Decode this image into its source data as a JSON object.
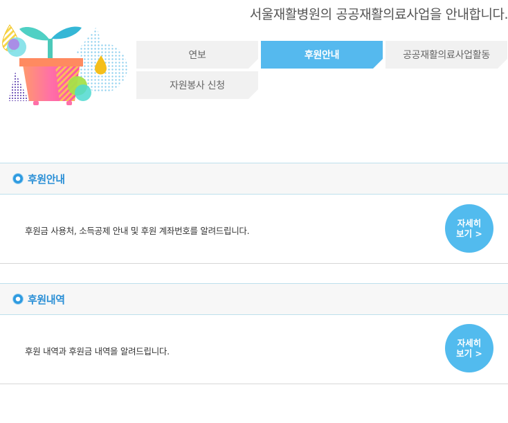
{
  "header": {
    "title": "서울재활병원의 공공재활의료사업을 안내합니다."
  },
  "tabs": [
    {
      "label": "연보",
      "active": false
    },
    {
      "label": "후원안내",
      "active": true
    },
    {
      "label": "공공재활의료사업활동",
      "active": false
    },
    {
      "label": "자원봉사 신청",
      "active": false
    }
  ],
  "sections": [
    {
      "title": "후원안내",
      "description": "후원금 사용처, 소득공제 안내 및 후원 계좌번호를 알려드립니다.",
      "button_line1": "자세히",
      "button_line2": "보기 >"
    },
    {
      "title": "후원내역",
      "description": "후원 내역과 후원금 내역을 알려드립니다.",
      "button_line1": "자세히",
      "button_line2": "보기 >"
    }
  ],
  "colors": {
    "accent": "#55b9ee",
    "section_title": "#2a8fd6"
  },
  "icons": {
    "illustration": "plant-pot-illustration",
    "bullet": "circle-bullet-icon"
  }
}
